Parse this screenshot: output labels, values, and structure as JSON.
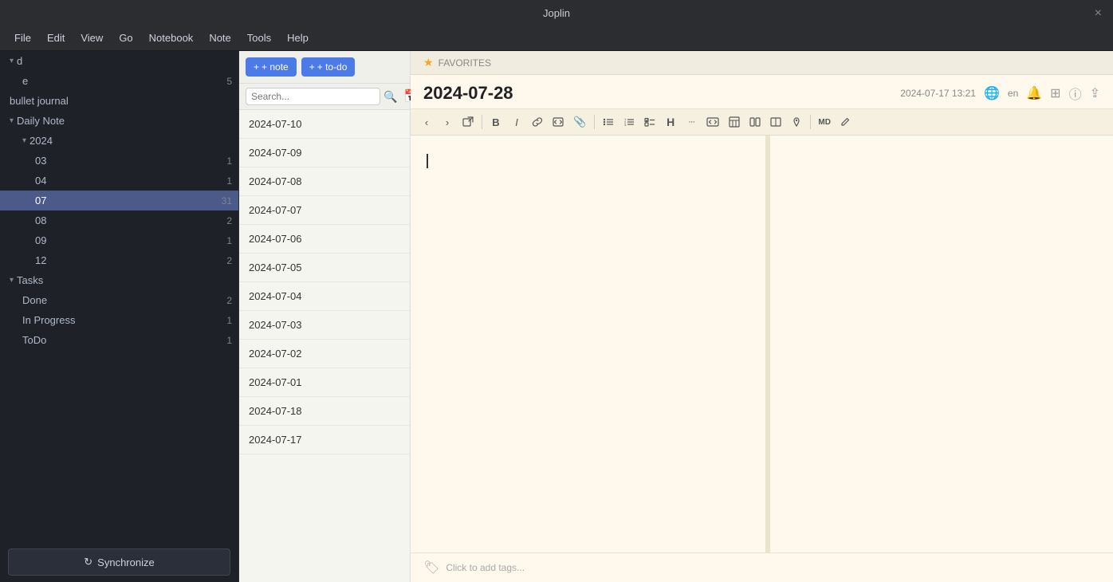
{
  "titlebar": {
    "title": "Joplin",
    "close_label": "×"
  },
  "menubar": {
    "items": [
      "File",
      "Edit",
      "View",
      "Go",
      "Notebook",
      "Note",
      "Tools",
      "Help"
    ]
  },
  "sidebar": {
    "top_item": {
      "label": "d",
      "count": ""
    },
    "item_e": {
      "label": "e",
      "count": "5"
    },
    "bullet_journal": {
      "label": "bullet journal"
    },
    "daily_note": {
      "label": "Daily Note",
      "expanded": true,
      "year_2024": {
        "label": "2024",
        "expanded": true,
        "items": [
          {
            "label": "03",
            "count": "1"
          },
          {
            "label": "04",
            "count": "1"
          },
          {
            "label": "07",
            "count": "31",
            "active": true
          },
          {
            "label": "08",
            "count": "2"
          },
          {
            "label": "09",
            "count": "1"
          },
          {
            "label": "12",
            "count": "2"
          }
        ]
      }
    },
    "tasks": {
      "label": "Tasks",
      "expanded": true,
      "items": [
        {
          "label": "Done",
          "count": "2"
        },
        {
          "label": "In Progress",
          "count": "1"
        },
        {
          "label": "ToDo",
          "count": "1"
        }
      ]
    },
    "sync_button": "Synchronize"
  },
  "note_list": {
    "new_note_label": "+ note",
    "new_todo_label": "+ to-do",
    "search_placeholder": "Search...",
    "notes": [
      "2024-07-10",
      "2024-07-09",
      "2024-07-08",
      "2024-07-07",
      "2024-07-06",
      "2024-07-05",
      "2024-07-04",
      "2024-07-03",
      "2024-07-02",
      "2024-07-01",
      "2024-07-18",
      "2024-07-17"
    ]
  },
  "editor": {
    "favorites_label": "FAVORITES",
    "note_title": "2024-07-28",
    "note_datetime": "2024-07-17 13:21",
    "note_lang": "en",
    "tags_placeholder": "Click to add tags...",
    "toolbar": {
      "back": "‹",
      "forward": "›",
      "external": "⊞",
      "bold": "B",
      "italic": "I",
      "link": "🔗",
      "code_block": "{}",
      "attachment": "📎",
      "bullet_list": "≡",
      "numbered_list": "≣",
      "checklist": "☑",
      "heading": "H",
      "hr": "···",
      "inline_code": "</>",
      "table_icon": "▦",
      "cols_icon": "⫿",
      "split_icon": "⧉",
      "map_icon": "⚲",
      "md_icon": "MD",
      "edit_icon": "✎"
    }
  }
}
